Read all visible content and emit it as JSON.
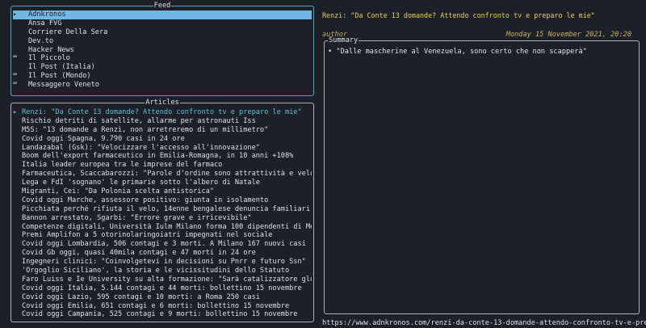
{
  "feed": {
    "title": "Feed",
    "items": [
      {
        "marker": "▸",
        "label": "Adnkronos",
        "selected": true
      },
      {
        "marker": "",
        "label": "Ansa FVG"
      },
      {
        "marker": "",
        "label": "Corriere Della Sera"
      },
      {
        "marker": "",
        "label": "Dev.to"
      },
      {
        "marker": "",
        "label": "Hacker News"
      },
      {
        "marker": "ꟹ",
        "label": "Il Piccolo"
      },
      {
        "marker": "",
        "label": "Il Post (Italia)"
      },
      {
        "marker": "ꟹ",
        "label": "Il Post (Mondo)"
      },
      {
        "marker": "ꟹ",
        "label": "Messaggero Veneto"
      }
    ]
  },
  "articles": {
    "title": "Articles",
    "items": [
      {
        "marker": "▸",
        "label": "Renzi: \"Da Conte 13 domande? Attendo confronto tv e preparo le mie\"",
        "current": true
      },
      {
        "marker": "",
        "label": "Rischio detriti di satellite, allarme per astronauti Iss"
      },
      {
        "marker": "",
        "label": "M5S: \"13 domande a Renzi, non arretreremo di un millimetro\""
      },
      {
        "marker": "",
        "label": "Covid oggi Spagna, 9.790 casi in 24 ore"
      },
      {
        "marker": "",
        "label": "Landazabal (Gsk): \"Velocizzare l'accesso all'innovazione\""
      },
      {
        "marker": "",
        "label": "Boom dell'export farmaceutico in Emilia-Romagna, in 10 anni +108%"
      },
      {
        "marker": "",
        "label": "Italia leader europea tra le imprese del farmaco"
      },
      {
        "marker": "",
        "label": "Farmaceutica, Scaccabarozzi: \"Parole d'ordine sono attrattività e velocità\""
      },
      {
        "marker": "",
        "label": "Lega e FdI 'sognano' le primarie sotto l'albero di Natale"
      },
      {
        "marker": "",
        "label": "Migranti, Cei: \"Da Polonia scelta antistorica\""
      },
      {
        "marker": "",
        "label": "Covid oggi Marche, assessore positivo: giunta in isolamento"
      },
      {
        "marker": "",
        "label": "Picchiata perché rifiuta il velo, 14enne bengalese denuncia familiari"
      },
      {
        "marker": "",
        "label": "Bannon arrestato, Sgarbi: \"Errore grave e irricevibile\""
      },
      {
        "marker": "",
        "label": "Competenze digitali, Università Iulm Milano forma 100 dipendenti di Meglio"
      },
      {
        "marker": "",
        "label": "Premi Amplifon a 5 otorinolaringoiatri impegnati nel sociale"
      },
      {
        "marker": "",
        "label": "Covid oggi Lombardia, 506 contagi e 3 morti. A Milano 167 nuovi casi"
      },
      {
        "marker": "",
        "label": "Covid Gb oggi, quasi 40mila contagi e 47 morti in 24 ore"
      },
      {
        "marker": "",
        "label": "Ingegneri clinici: \"Coinvolgetevi in decisioni su Pnrr e futuro Ssn\""
      },
      {
        "marker": "",
        "label": "'Orgoglio Siciliano', la storia e le vicissitudini dello Statuto"
      },
      {
        "marker": "",
        "label": "Faro Luiss e Ie University su alta formazione: \"Sarà catalizzatore globale"
      },
      {
        "marker": "",
        "label": "Covid oggi Italia, 5.144 contagi e 44 morti: bollettino 15 novembre"
      },
      {
        "marker": "",
        "label": "Covid oggi Lazio, 595 contagi e 10 morti: a Roma 250 casi"
      },
      {
        "marker": "",
        "label": "Covid oggi Emilia, 651 contagi e 6 morti: bollettino 15 novembre"
      },
      {
        "marker": "",
        "label": "Covid oggi Campania, 525 contagi e 9 morti: bollettino 15 novembre"
      }
    ]
  },
  "detail": {
    "title": "Renzi: \"Da Conte 13 domande? Attendo confronto tv e preparo le mie\"",
    "author": "author",
    "date": "Monday 15 November 2021, 20:20",
    "summary_title": "Summary",
    "summary_bullet": "•",
    "summary_text": "\"Dalle mascherine al Venezuela, sono certo che non scapperà\"",
    "url": "https://www.adnkronos.com/renzi-da-conte-13-domande-attendo-confronto-tv-e-preparo-"
  },
  "colors": {
    "background": "#1d2027",
    "selection": "#72b7e3",
    "title_yellow": "#e6d35a",
    "cyan": "#5ec0d6"
  }
}
